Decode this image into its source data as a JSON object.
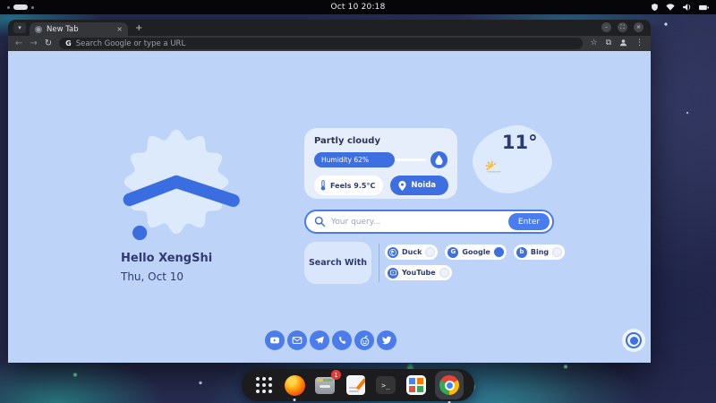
{
  "system_bar": {
    "clock": "Oct 10 20:18",
    "status_icons": [
      "privacy-shield",
      "wifi",
      "volume",
      "battery"
    ]
  },
  "browser": {
    "tab_title": "New Tab",
    "new_tab_button": "+",
    "close_tab": "×",
    "window_controls": {
      "minimize": "–",
      "restore": "⛶",
      "close": "×"
    },
    "url_placeholder": "Search Google or type a URL",
    "g_badge": "G"
  },
  "newtab": {
    "greeting": "Hello XengShi",
    "date": "Thu, Oct 10",
    "weather": {
      "condition": "Partly cloudy",
      "humidity_label": "Humidity 62%",
      "humidity_percent": 62,
      "feels_label": "Feels 9.5°C",
      "city": "Noida",
      "temperature": "11°",
      "sky_emoji": "⛅"
    },
    "search": {
      "placeholder": "Your query...",
      "enter_label": "Enter"
    },
    "search_with": {
      "label": "Search With",
      "options": [
        {
          "label": "Duck",
          "selected": false,
          "icon": "duckduckgo"
        },
        {
          "label": "Google",
          "selected": true,
          "icon": "google",
          "glyph": "G"
        },
        {
          "label": "Bing",
          "selected": false,
          "icon": "bing",
          "glyph": "b"
        },
        {
          "label": "YouTube",
          "selected": false,
          "icon": "youtube"
        }
      ]
    },
    "social": [
      "YouTube",
      "Mail",
      "Telegram",
      "WhatsApp",
      "Reddit",
      "Twitter"
    ]
  },
  "dock": {
    "items": [
      "app-grid",
      "firefox",
      "files",
      "text-editor",
      "terminal",
      "app-store",
      "chrome"
    ],
    "files_badge": "1"
  },
  "colors": {
    "accent_blue": "#3e6fe1",
    "page_bg": "#bdd3f8",
    "card_bg": "#e6eefc",
    "navy_text": "#2f3b70",
    "badge_red": "#e53935"
  }
}
